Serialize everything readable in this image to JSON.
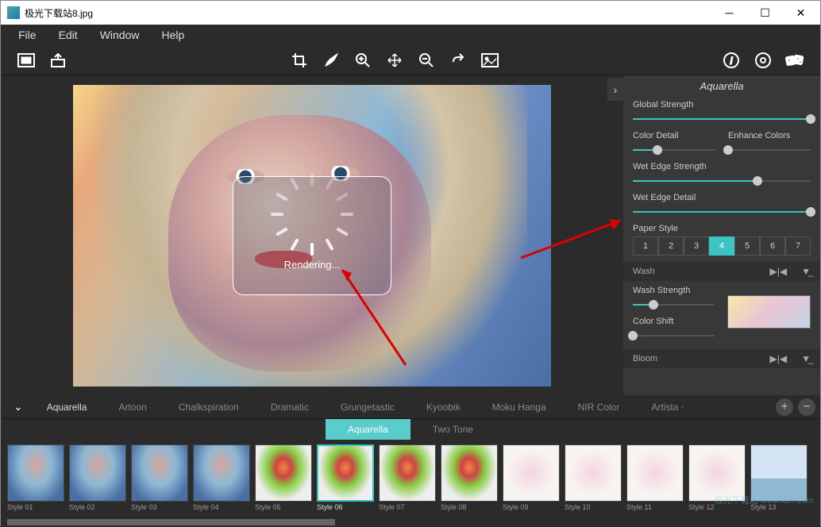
{
  "window": {
    "title": "极光下载站8.jpg"
  },
  "menu": {
    "file": "File",
    "edit": "Edit",
    "window": "Window",
    "help": "Help"
  },
  "panel": {
    "title": "Aquarella",
    "global_strength": "Global Strength",
    "color_detail": "Color Detail",
    "enhance_colors": "Enhance Colors",
    "wet_edge_strength": "Wet Edge Strength",
    "wet_edge_detail": "Wet Edge Detail",
    "paper_style": "Paper Style",
    "paper": [
      "1",
      "2",
      "3",
      "4",
      "5",
      "6",
      "7"
    ],
    "wash": "Wash",
    "wash_strength": "Wash Strength",
    "color_shift": "Color Shift",
    "bloom": "Bloom"
  },
  "sliders": {
    "global_strength": 100,
    "color_detail": 30,
    "enhance_colors": 0,
    "wet_edge_strength": 70,
    "wet_edge_detail": 100,
    "wash_strength": 25,
    "color_shift": 0
  },
  "rendering": "Rendering...",
  "categories": [
    "Aquarella",
    "Artoon",
    "Chalkspiration",
    "Dramatic",
    "Grungetastic",
    "Kyoobik",
    "Moku Hanga",
    "NIR Color",
    "Artista ‧"
  ],
  "subtabs": [
    "Aquarella",
    "Two Tone"
  ],
  "styles": [
    "Style 01",
    "Style 02",
    "Style 03",
    "Style 04",
    "Style 05",
    "Style 06",
    "Style 07",
    "Style 08",
    "Style 09",
    "Style 10",
    "Style 11",
    "Style 12",
    "Style 13"
  ],
  "watermark": "极光下载站\nwww.xz7.com"
}
